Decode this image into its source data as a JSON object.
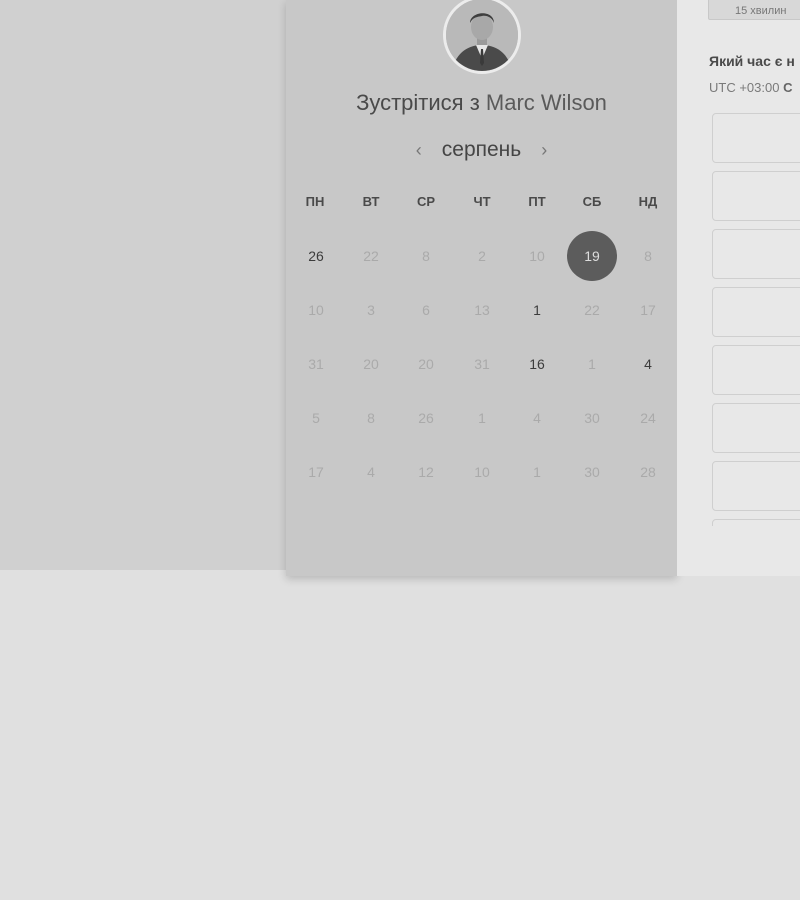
{
  "meeting": {
    "title_prefix": "Зустрітися з",
    "host_name": "Marc Wilson"
  },
  "calendar": {
    "month": "серпень",
    "prev_icon": "‹",
    "next_icon": "›",
    "weekdays": [
      "ПН",
      "ВТ",
      "СР",
      "ЧТ",
      "ПТ",
      "СБ",
      "НД"
    ],
    "weeks": [
      [
        {
          "d": "26",
          "s": "avail"
        },
        {
          "d": "22",
          "s": "off"
        },
        {
          "d": "8",
          "s": "off"
        },
        {
          "d": "2",
          "s": "off"
        },
        {
          "d": "10",
          "s": "off"
        },
        {
          "d": "19",
          "s": "selected"
        },
        {
          "d": "8",
          "s": "off"
        }
      ],
      [
        {
          "d": "10",
          "s": "off"
        },
        {
          "d": "3",
          "s": "off"
        },
        {
          "d": "6",
          "s": "off"
        },
        {
          "d": "13",
          "s": "off"
        },
        {
          "d": "1",
          "s": "avail"
        },
        {
          "d": "22",
          "s": "off"
        },
        {
          "d": "17",
          "s": "off"
        }
      ],
      [
        {
          "d": "31",
          "s": "off"
        },
        {
          "d": "20",
          "s": "off"
        },
        {
          "d": "20",
          "s": "off"
        },
        {
          "d": "31",
          "s": "off"
        },
        {
          "d": "16",
          "s": "avail"
        },
        {
          "d": "1",
          "s": "off"
        },
        {
          "d": "4",
          "s": "avail"
        }
      ],
      [
        {
          "d": "5",
          "s": "off"
        },
        {
          "d": "8",
          "s": "off"
        },
        {
          "d": "26",
          "s": "off"
        },
        {
          "d": "1",
          "s": "off"
        },
        {
          "d": "4",
          "s": "off"
        },
        {
          "d": "30",
          "s": "off"
        },
        {
          "d": "24",
          "s": "off"
        }
      ],
      [
        {
          "d": "17",
          "s": "off"
        },
        {
          "d": "4",
          "s": "off"
        },
        {
          "d": "12",
          "s": "off"
        },
        {
          "d": "10",
          "s": "off"
        },
        {
          "d": "1",
          "s": "off"
        },
        {
          "d": "30",
          "s": "off"
        },
        {
          "d": "28",
          "s": "off"
        }
      ]
    ]
  },
  "scheduler": {
    "duration_label": "15 хвилин",
    "question": "Який час є н",
    "timezone_prefix": "UTC +03:00",
    "timezone_suffix": "С",
    "slots": [
      "",
      "",
      "",
      "",
      "",
      "",
      "",
      ""
    ]
  },
  "colors": {
    "selected_day": "#5c5c5c",
    "available_day": "#3c3c3c",
    "unavailable_day": "#aaaaaa"
  }
}
